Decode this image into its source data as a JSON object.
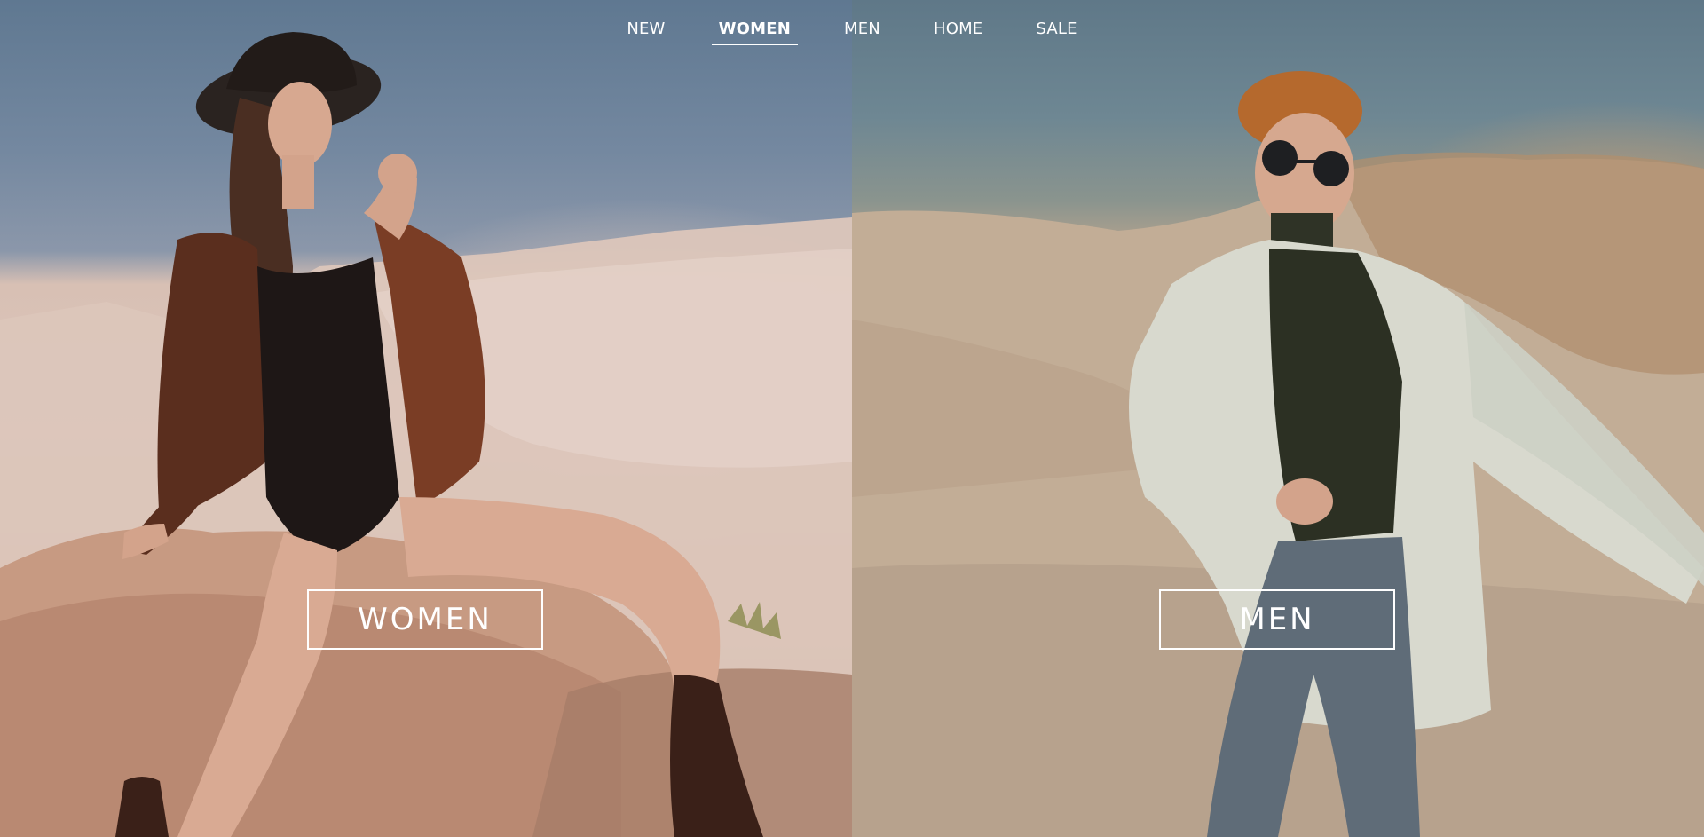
{
  "nav": {
    "items": [
      {
        "label": "NEW",
        "active": false
      },
      {
        "label": "WOMEN",
        "active": true
      },
      {
        "label": "MEN",
        "active": false
      },
      {
        "label": "HOME",
        "active": false
      },
      {
        "label": "SALE",
        "active": false
      }
    ]
  },
  "hero": {
    "women": {
      "cta_label": "WOMEN",
      "image": "woman-in-cowboy-hat-photo"
    },
    "men": {
      "cta_label": "MEN",
      "image": "man-in-plaid-shirt-photo"
    }
  },
  "colors": {
    "text": "#ffffff",
    "sky_left": "#5f7891",
    "sand_left": "#dcc6bb",
    "sky_right": "#5f7888",
    "sand_right": "#c2ad96"
  }
}
